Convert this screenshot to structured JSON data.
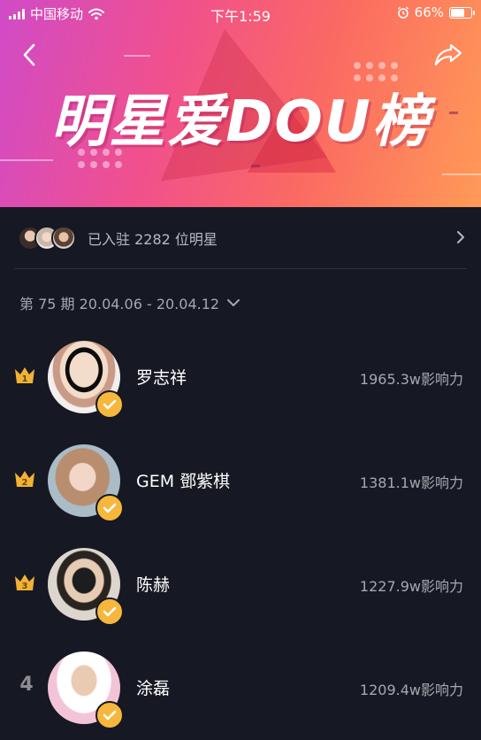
{
  "status_bar": {
    "carrier": "中国移动",
    "time": "下午1:59",
    "battery": "66%",
    "battery_level": 0.66
  },
  "header": {
    "title": "明星爱DOU榜",
    "back_icon": "chevron-left-icon",
    "share_icon": "share-arrow-icon"
  },
  "colors": {
    "banner_start": "#d04bc8",
    "banner_end": "#ff9a57",
    "background": "#161823",
    "verified": "#f6b73c",
    "crown": "#f2b233"
  },
  "joined": {
    "text": "已入驻 2282 位明星"
  },
  "period": {
    "label": "第 75 期 20.04.06 - 20.04.12"
  },
  "rankings": [
    {
      "rank": "1",
      "name": "罗志祥",
      "score": "1965.3w影响力"
    },
    {
      "rank": "2",
      "name": "GEM 鄧紫棋",
      "score": "1381.1w影响力"
    },
    {
      "rank": "3",
      "name": "陈赫",
      "score": "1227.9w影响力"
    },
    {
      "rank": "4",
      "name": "涂磊",
      "score": "1209.4w影响力"
    }
  ]
}
